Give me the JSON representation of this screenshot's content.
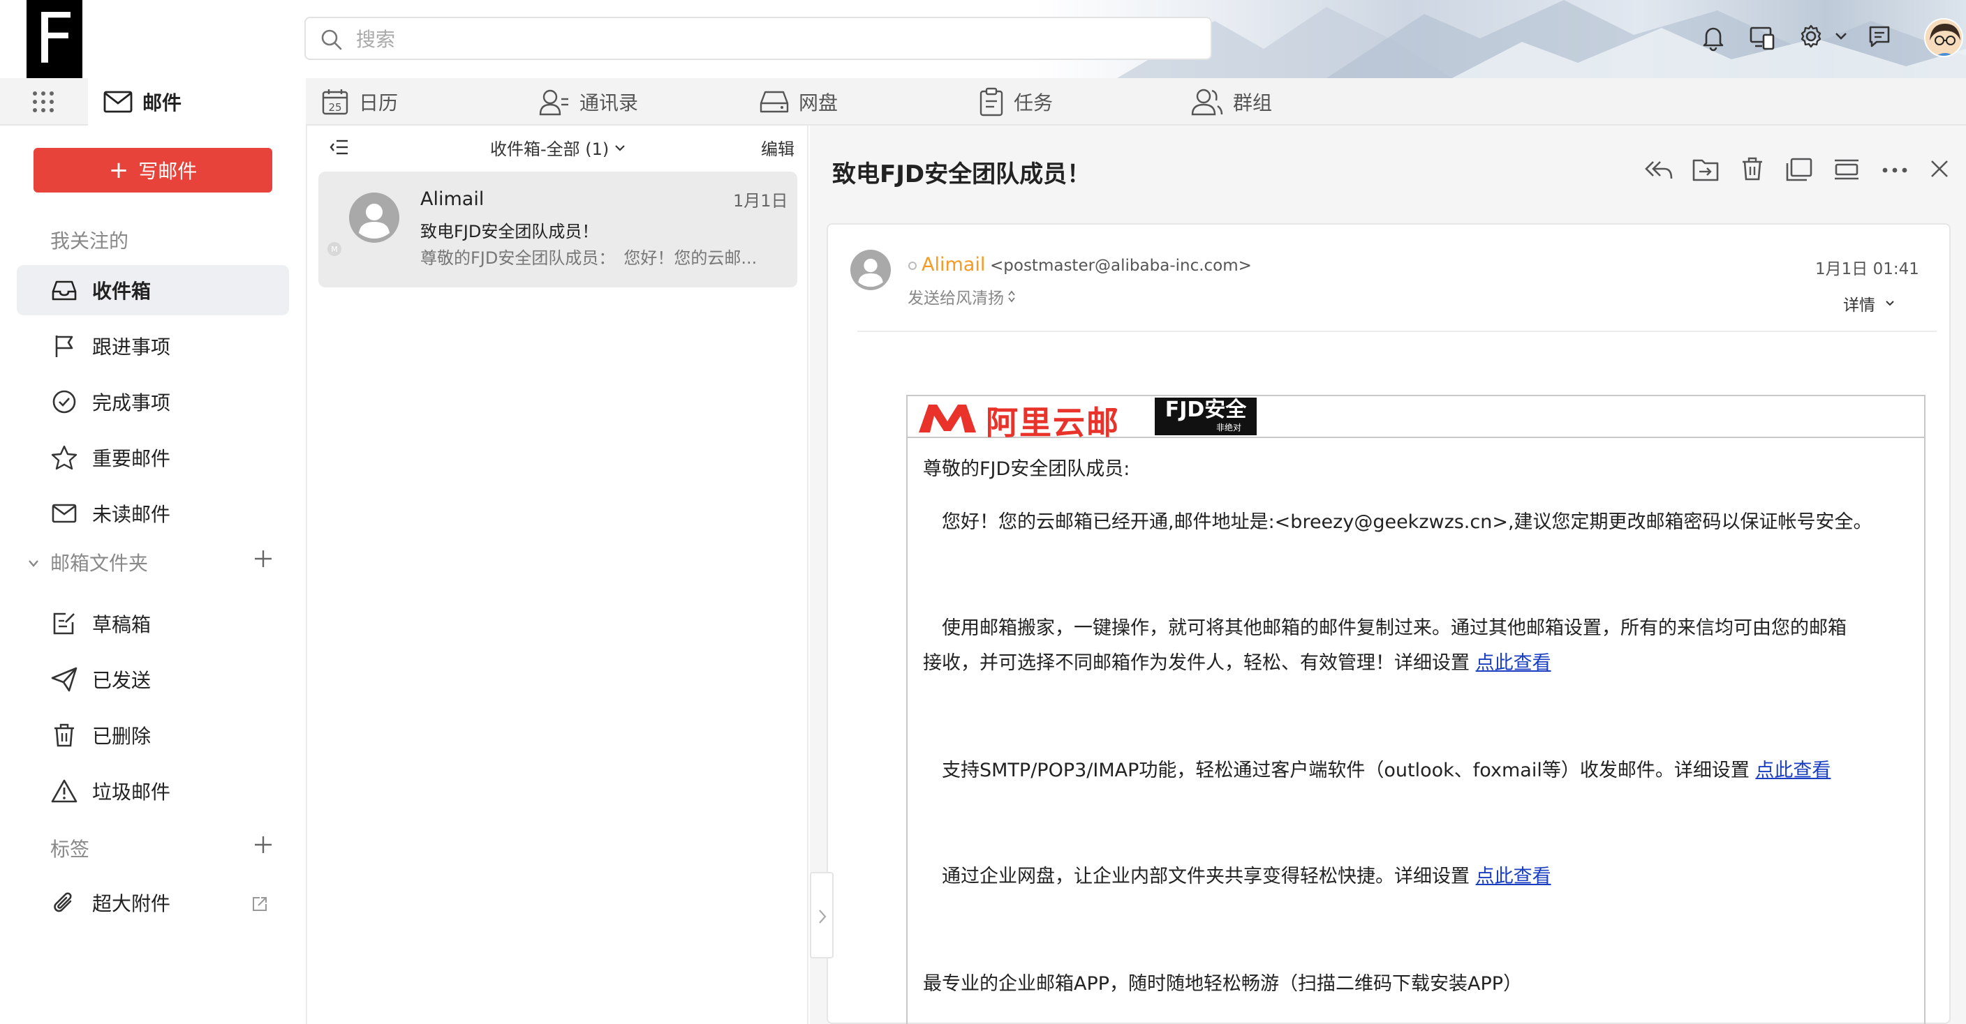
{
  "app": {
    "logo_letter": "F",
    "search_placeholder": "搜索"
  },
  "header_icons": [
    "bell-icon",
    "devices-icon",
    "gear-icon",
    "chevron-down-icon",
    "feedback-icon"
  ],
  "tabs": [
    {
      "label": "邮件",
      "icon": "mail-icon",
      "active": true
    },
    {
      "label": "日历",
      "icon": "calendar-icon",
      "badge": "25"
    },
    {
      "label": "通讯录",
      "icon": "contacts-icon"
    },
    {
      "label": "网盘",
      "icon": "drive-icon"
    },
    {
      "label": "任务",
      "icon": "task-icon"
    },
    {
      "label": "群组",
      "icon": "group-icon"
    }
  ],
  "sidebar": {
    "compose_label": "写邮件",
    "following_title": "我关注的",
    "following": [
      {
        "label": "收件箱",
        "icon": "inbox-icon",
        "active": true
      },
      {
        "label": "跟进事项",
        "icon": "flag-icon"
      },
      {
        "label": "完成事项",
        "icon": "check-circle-icon"
      },
      {
        "label": "重要邮件",
        "icon": "star-icon"
      },
      {
        "label": "未读邮件",
        "icon": "envelope-icon"
      }
    ],
    "folders_title": "邮箱文件夹",
    "folders": [
      {
        "label": "草稿箱",
        "icon": "draft-icon"
      },
      {
        "label": "已发送",
        "icon": "send-icon"
      },
      {
        "label": "已删除",
        "icon": "trash-icon"
      },
      {
        "label": "垃圾邮件",
        "icon": "warning-icon"
      }
    ],
    "tags_title": "标签",
    "attachment_label": "超大附件"
  },
  "mail_list": {
    "folder_label": "收件箱-全部 (1)",
    "edit_label": "编辑",
    "items": [
      {
        "sender": "Alimail",
        "date": "1月1日",
        "subject": "致电FJD安全团队成员！",
        "preview": "尊敬的FJD安全团队成员：　您好！您的云邮..."
      }
    ]
  },
  "reader": {
    "subject": "致电FJD安全团队成员！",
    "sender_name": "Alimail",
    "sender_email": "<postmaster@alibaba-inc.com>",
    "datetime": "1月1日 01:41",
    "to_label": "发送给风清扬",
    "details_label": "详情",
    "banner_brand": "阿里云邮",
    "banner_logo": "FJD安全",
    "banner_logo_sub": "非绝对",
    "body": {
      "greeting": "尊敬的FJD安全团队成员:",
      "p1": "　您好！您的云邮箱已经开通,邮件地址是:<breezy@geekzwzs.cn>,建议您定期更改邮箱密码以保证帐号安全。",
      "p2a": "　使用邮箱搬家，一键操作，就可将其他邮箱的邮件复制过来。通过其他邮箱设置，所有的来信均可由您的邮箱",
      "p2b": "接收，并可选择不同邮箱作为发件人，轻松、有效管理！详细设置 ",
      "p3": "　支持SMTP/POP3/IMAP功能，轻松通过客户端软件（outlook、foxmail等）收发邮件。详细设置 ",
      "p4": "　通过企业网盘，让企业内部文件夹共享变得轻松快捷。详细设置 ",
      "p5": "最专业的企业邮箱APP，随时随地轻松畅游（扫描二维码下载安装APP）",
      "link_label": "点此查看"
    }
  }
}
